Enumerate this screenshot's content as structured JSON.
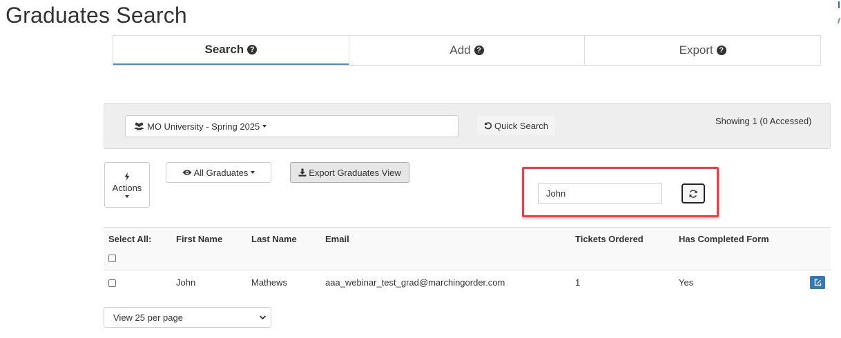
{
  "page": {
    "title": "Graduates Search"
  },
  "tabs": [
    {
      "label": "Search",
      "active": true
    },
    {
      "label": "Add",
      "active": false
    },
    {
      "label": "Export",
      "active": false
    }
  ],
  "filter_bar": {
    "group_select": {
      "value": "MO University - Spring 2025",
      "icon": "users-icon"
    },
    "quick_search_label": "Quick Search",
    "showing_text": "Showing 1 (0 Accessed)"
  },
  "toolbar": {
    "actions_label": "Actions",
    "all_graduates_label": "All Graduates",
    "export_view_label": "Export Graduates View"
  },
  "search": {
    "value": "John"
  },
  "table": {
    "select_all_label": "Select All:",
    "columns": [
      "First Name",
      "Last Name",
      "Email",
      "Tickets Ordered",
      "Has Completed Form"
    ],
    "rows": [
      {
        "first_name": "John",
        "last_name": "Mathews",
        "email": "aaa_webinar_test_grad@marchingorder.com",
        "tickets_ordered": "1",
        "has_completed_form": "Yes"
      }
    ]
  },
  "pagination": {
    "per_page_value": "View 25 per page"
  },
  "colors": {
    "highlight": "#e0454f",
    "active_tab_underline": "#4a90c8",
    "edit_button": "#337ab7"
  }
}
